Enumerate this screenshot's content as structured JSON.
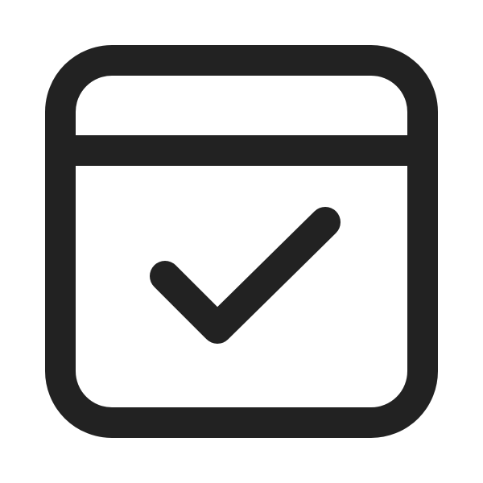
{
  "icon": {
    "name": "calendar-checkmark-icon",
    "stroke_color": "#222222",
    "background_color": "#ffffff"
  }
}
